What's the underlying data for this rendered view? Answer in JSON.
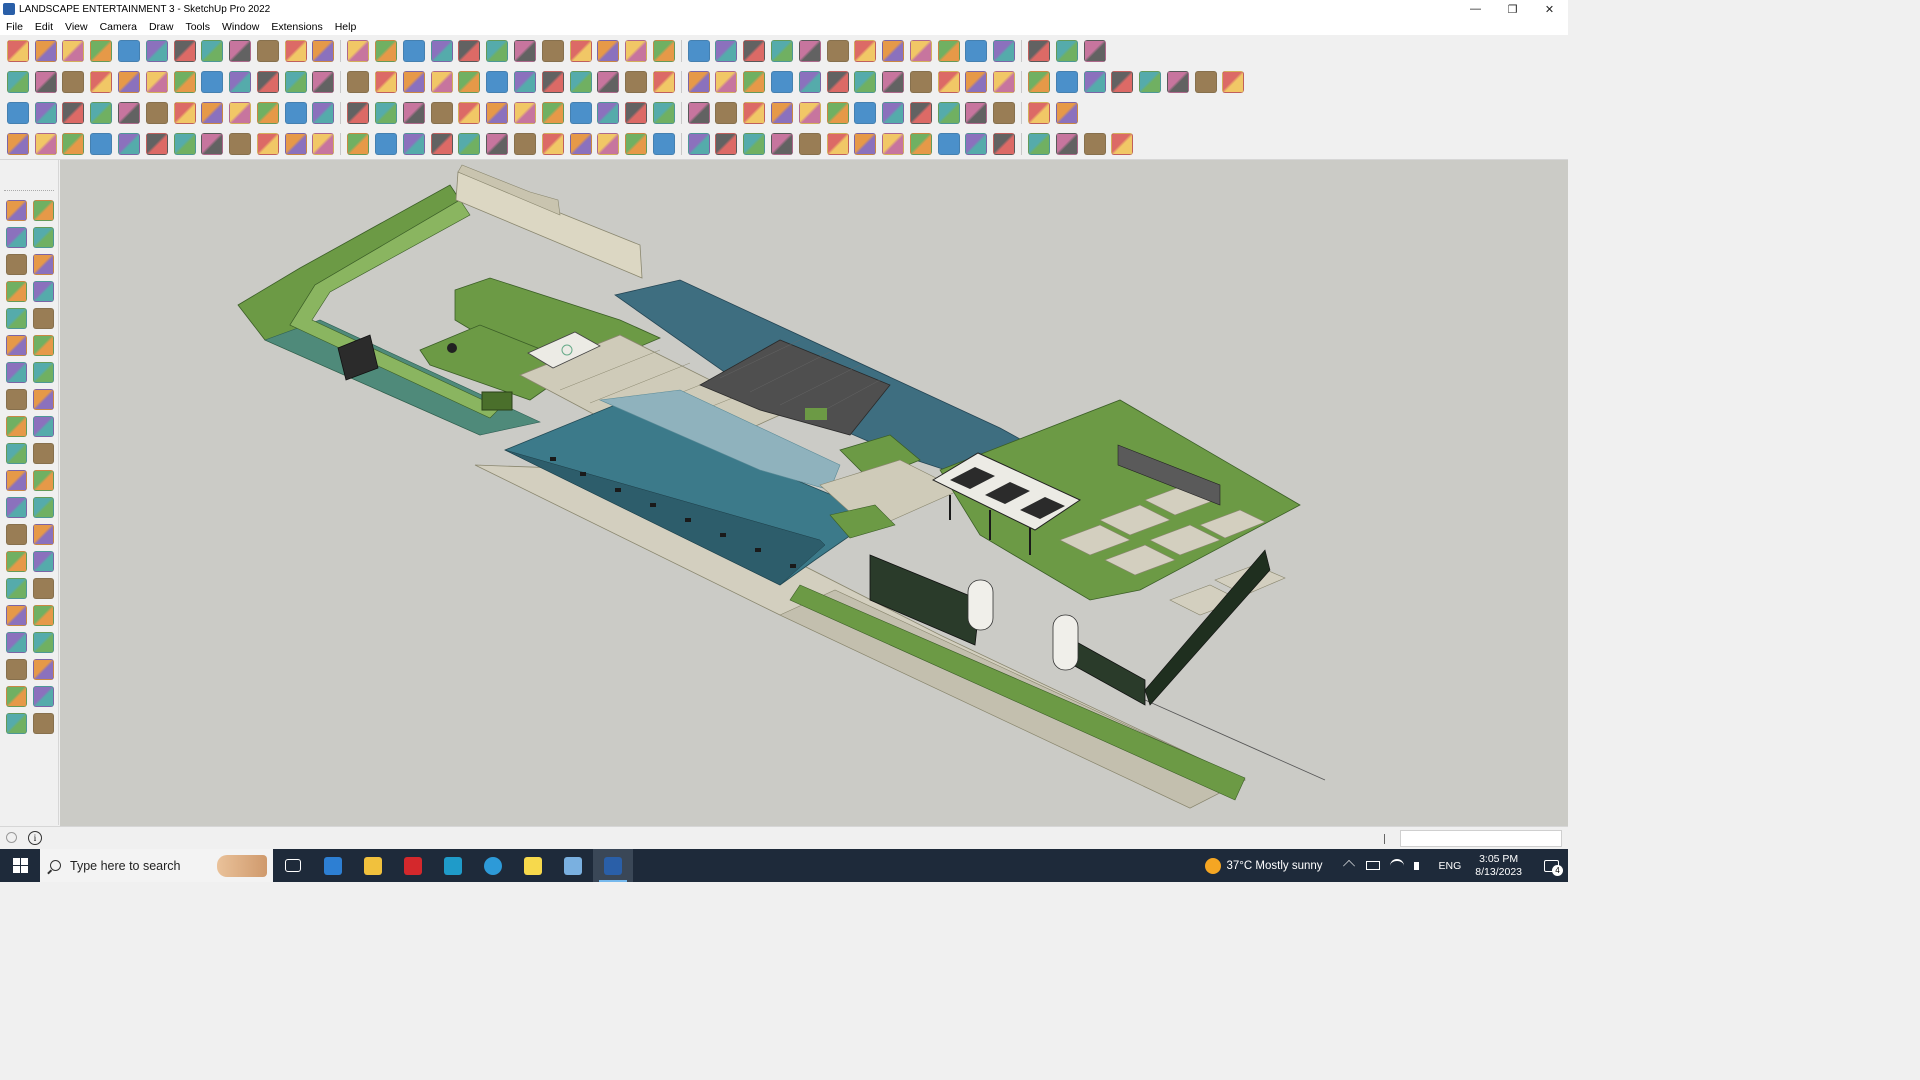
{
  "window": {
    "title": "LANDSCAPE ENTERTAINMENT 3 - SketchUp Pro 2022",
    "controls": [
      "—",
      "❐",
      "✕"
    ]
  },
  "menu": [
    "File",
    "Edit",
    "View",
    "Camera",
    "Draw",
    "Tools",
    "Window",
    "Extensions",
    "Help"
  ],
  "toolbars": {
    "row1": [
      "zoom-extents",
      "select",
      "select-dropdown",
      "eraser",
      "line",
      "line-dropdown",
      "arc",
      "arc-dropdown",
      "rectangle",
      "rect-dropdown",
      "push-pull",
      "follow-me",
      "move",
      "rotate",
      "scale",
      "tape-measure",
      "text",
      "paint-bucket",
      "orbit",
      "pan",
      "zoom",
      "zoom-window",
      "section-plane",
      "section-cut",
      "layers",
      "styles",
      "user-account",
      "account-dropdown",
      "component-browser",
      "material-browser",
      "extension-1",
      "sandbox-1",
      "sandbox-2",
      "sandbox-3",
      "position-camera",
      "axes",
      "undo",
      "redo",
      "warehouse"
    ],
    "row2": [
      "component-1",
      "component-2",
      "component-3",
      "push-1",
      "push-2",
      "push-3",
      "push-4",
      "push-5",
      "push-6",
      "push-7",
      "offset-curve",
      "face-1",
      "face-2",
      "face-3",
      "sheet-1",
      "sheet-2",
      "house-1",
      "house-2",
      "house-3",
      "house-4",
      "house-5",
      "fx-tool",
      "extension-2",
      "extension-3",
      "shape-1",
      "shape-2",
      "shape-3",
      "shape-4",
      "shape-5",
      "shape-6",
      "shape-7",
      "shape-8",
      "shape-9",
      "shape-10",
      "shape-11",
      "pencil-red",
      "eraser-pink",
      "solid-1",
      "solid-2",
      "solid-3",
      "solid-4",
      "solid-5",
      "solid-6",
      "solid-7"
    ],
    "row3": [
      "blue-plane",
      "blue-diamond",
      "yellow-diamond",
      "green-diamond",
      "red-diamond",
      "white-diamond",
      "loop",
      "red-square",
      "stack",
      "bend",
      "wood",
      "pipe",
      "curve-1",
      "dots-curve",
      "red-cross",
      "green-cross",
      "blue-cross",
      "cone-blue",
      "cone-teal",
      "cone-yellow",
      "hook",
      "orange-hook",
      "spiral",
      "move-4",
      "cube-brown",
      "magnet",
      "puzzle",
      "blocks-1",
      "blocks-2",
      "blocks-3",
      "brick",
      "grid-1",
      "grid-2",
      "grid-3",
      "grid-4",
      "dots-red",
      "dotted-circle",
      "matrix"
    ],
    "row4": [
      "draw-1",
      "draw-2",
      "draw-3",
      "draw-4",
      "gear",
      "cloud",
      "bend-2",
      "box-3d",
      "skull",
      "cut",
      "corner-1",
      "corner-2",
      "needle",
      "curve-red",
      "barrel",
      "knife",
      "columns",
      "comb",
      "hand",
      "leaf",
      "arrow-left",
      "rows",
      "slash",
      "fork-1",
      "fork-2",
      "fork-3",
      "chair-1",
      "chair-2",
      "step-1",
      "step-2",
      "panel-1",
      "panel-2",
      "panel-3",
      "panel-4",
      "panel-5",
      "flower-1",
      "flower-2",
      "flower-3",
      "flower-4",
      "pentagon"
    ]
  },
  "left_tools": [
    "select-arrow",
    "paint",
    "eraser-red",
    "tape",
    "pencil-red",
    "freehand",
    "rectangle",
    "rotated-rect",
    "circle",
    "polygon",
    "arc-1",
    "arc-2",
    "pie",
    "arc-3",
    "move-red",
    "push-pull",
    "rotate-red",
    "follow-me-red",
    "scale",
    "offset-red",
    "tape-measure",
    "dimension",
    "protractor",
    "text-label",
    "axes",
    "3d-text",
    "orbit",
    "pan-hand",
    "zoom",
    "zoom-window",
    "zoom-extents",
    "previous-view",
    "walk",
    "look-around",
    "footprints",
    "position-camera",
    "section-plane",
    "section-fill",
    "layers-1",
    "layers-2"
  ],
  "status": {
    "measurements_value": ""
  },
  "taskbar": {
    "search_placeholder": "Type here to search",
    "apps": [
      "task-view",
      "calculator",
      "file-explorer",
      "acrobat",
      "app-3",
      "edge",
      "sticky-notes",
      "layout",
      "sketchup"
    ],
    "weather": "37°C  Mostly sunny",
    "language": "ENG",
    "time": "3:05 PM",
    "date": "8/13/2023",
    "notification_count": "4"
  },
  "colors": {
    "lawn": "#5d8f3d",
    "lawn_dark": "#3f6e2a",
    "paving": "#cfcbb9",
    "paving_dark": "#b9b5a2",
    "glass": "#3e7e8e",
    "glass_dark": "#2d5f6b",
    "roof_dark": "#4d4d4d",
    "viewport_bg": "#cbcbc6"
  }
}
